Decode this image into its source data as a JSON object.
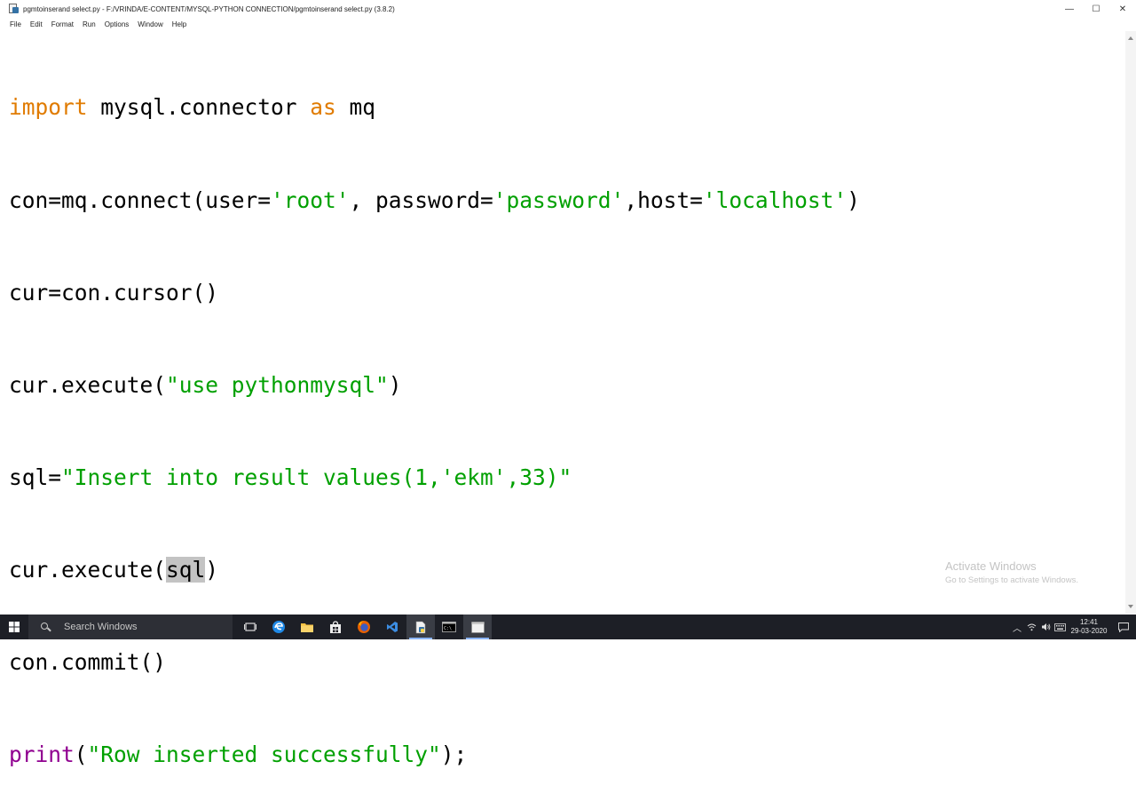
{
  "window": {
    "title": "pgmtoinserand select.py - F:/VRINDA/E-CONTENT/MYSQL-PYTHON CONNECTION/pgmtoinserand select.py (3.8.2)",
    "controls": {
      "minimize": "—",
      "maximize": "☐",
      "close": "✕"
    }
  },
  "menu": [
    "File",
    "Edit",
    "Format",
    "Run",
    "Options",
    "Window",
    "Help"
  ],
  "code": {
    "line1": {
      "kw": "import",
      "text": " mysql.connector ",
      "kw2": "as",
      "text2": " mq"
    },
    "line2": {
      "a": "con=mq.connect(user=",
      "s1": "'root'",
      "b": ", password=",
      "s2": "'password'",
      "c": ",host=",
      "s3": "'localhost'",
      "d": ")"
    },
    "line3": {
      "a": "cur=con.cursor()"
    },
    "line4": {
      "a": "cur.execute(",
      "s1": "\"use pythonmysql\"",
      "b": ")"
    },
    "line5": {
      "a": "sql=",
      "s1": "\"Insert into result values(1,'ekm',33)\""
    },
    "line6": {
      "a": "cur.execute(",
      "sel": "sql",
      "b": ")"
    },
    "line7": {
      "a": "con.commit()"
    },
    "line8": {
      "bi": "print",
      "a": "(",
      "s1": "\"Row inserted successfully\"",
      "b": ");"
    }
  },
  "watermark": {
    "title": "Activate Windows",
    "subtitle": "Go to Settings to activate Windows."
  },
  "taskbar": {
    "search_placeholder": "Search Windows",
    "time": "12:41",
    "date": "29-03-2020"
  },
  "colors": {
    "keyword": "#e07b00",
    "string": "#00a000",
    "builtin": "#900090",
    "selection": "#c3c3c3",
    "taskbar": "#1d1f26"
  }
}
